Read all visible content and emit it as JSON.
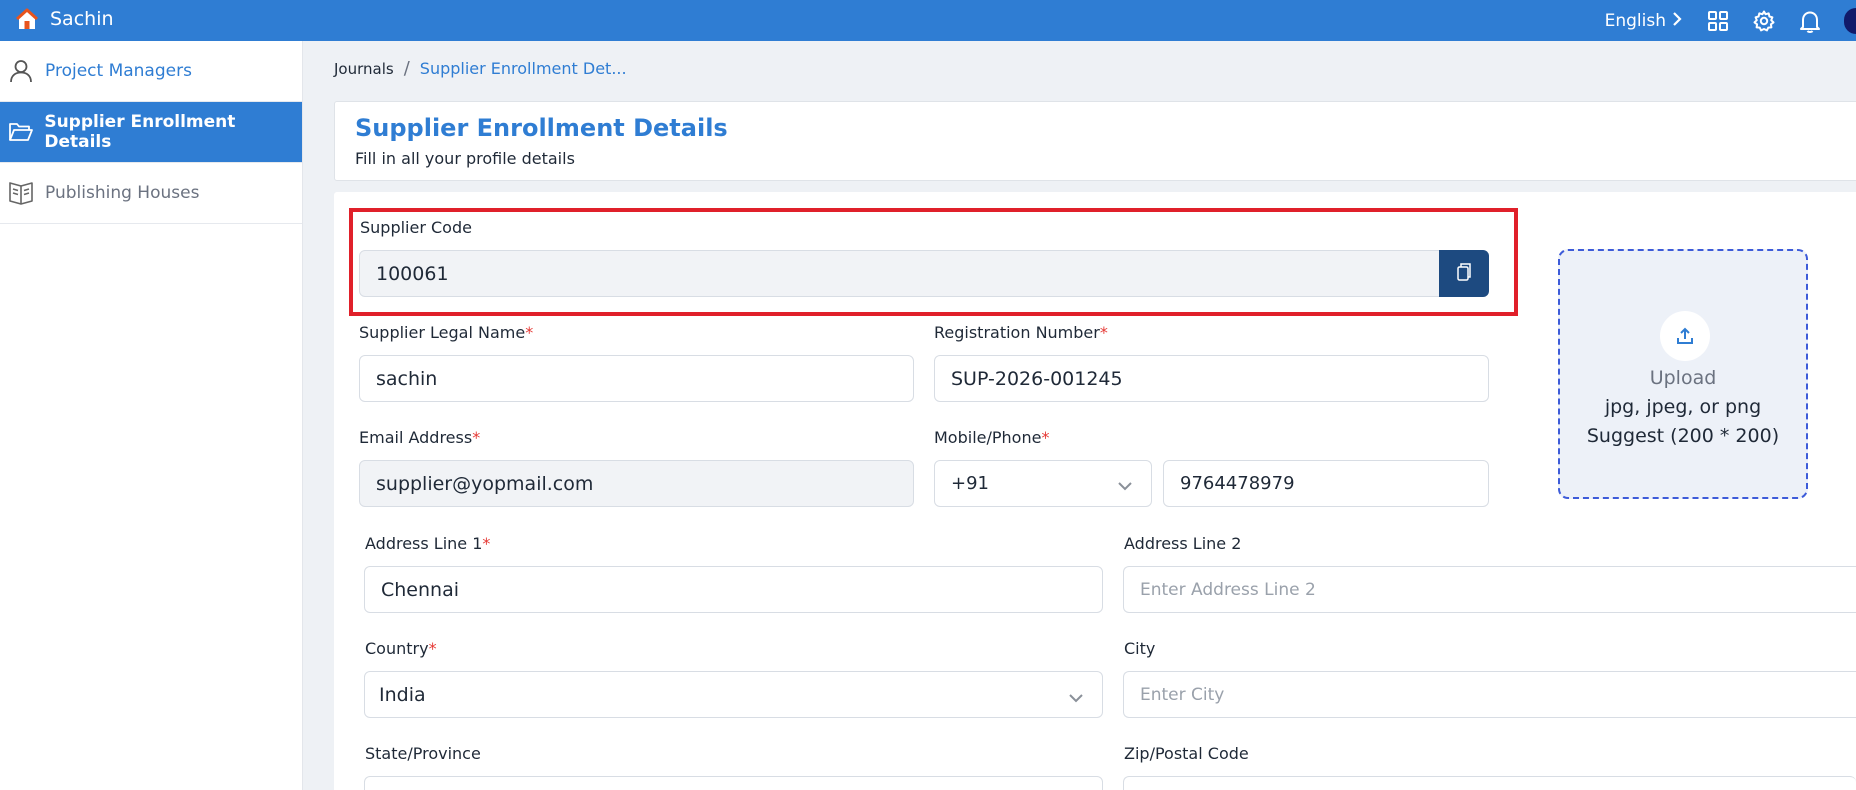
{
  "app": {
    "user_name": "Sachin",
    "language": "English"
  },
  "topbar": {
    "icons": [
      "home-icon",
      "grid-icon",
      "gear-icon",
      "bell-icon"
    ],
    "colors": {
      "brand": "#2f7dd3"
    }
  },
  "sidebar": {
    "items": [
      {
        "label": "Project Managers",
        "icon": "person-icon"
      },
      {
        "label": "Supplier Enrollment Details",
        "icon": "folder-icon"
      },
      {
        "label": "Publishing Houses",
        "icon": "book-icon"
      }
    ]
  },
  "breadcrumb": {
    "root": "Journals",
    "separator": "/",
    "current": "Supplier Enrollment Det..."
  },
  "page": {
    "title": "Supplier Enrollment Details",
    "subtitle": "Fill in all your profile details"
  },
  "form": {
    "supplier_code": {
      "label": "Supplier Code",
      "value": "100061"
    },
    "legal_name": {
      "label": "Supplier Legal Name",
      "value": "sachin"
    },
    "registration": {
      "label": "Registration Number",
      "value": "SUP-2026-001245"
    },
    "email": {
      "label": "Email Address",
      "value": "supplier@yopmail.com"
    },
    "phone": {
      "label": "Mobile/Phone",
      "code": "+91",
      "value": "9764478979"
    },
    "address1": {
      "label": "Address Line 1",
      "value": "Chennai"
    },
    "address2": {
      "label": "Address Line 2",
      "placeholder": "Enter Address Line 2"
    },
    "country": {
      "label": "Country",
      "value": "India"
    },
    "city": {
      "label": "City",
      "placeholder": "Enter City"
    },
    "state": {
      "label": "State/Province"
    },
    "zip": {
      "label": "Zip/Postal Code"
    },
    "required_marker": "*"
  },
  "upload": {
    "title": "Upload",
    "formats": "jpg, jpeg, or png",
    "size_hint": "Suggest (200 * 200)"
  }
}
